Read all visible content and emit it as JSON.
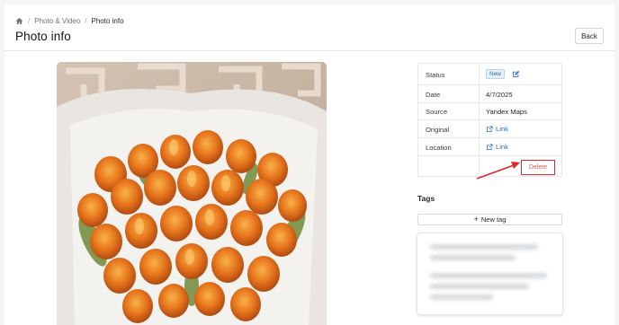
{
  "breadcrumb": {
    "items": [
      "Photo & Video",
      "Photo info"
    ]
  },
  "header": {
    "title": "Photo info",
    "back_label": "Back"
  },
  "info": {
    "rows": [
      {
        "label": "Status",
        "value": "New"
      },
      {
        "label": "Date",
        "value": "4/7/2025"
      },
      {
        "label": "Source",
        "value": "Yandex Maps"
      },
      {
        "label": "Original",
        "value": "Link"
      },
      {
        "label": "Location",
        "value": "Link"
      }
    ],
    "delete_label": "Delete"
  },
  "tags": {
    "heading": "Tags",
    "new_tag_label": "New tag"
  },
  "colors": {
    "accent": "#2968c8",
    "danger": "#e3262b",
    "badge_bg": "#e6f0fb"
  },
  "icons": {
    "home": "home-icon",
    "edit": "edit-icon",
    "external_link": "external-link-icon",
    "plus": "plus-icon"
  }
}
